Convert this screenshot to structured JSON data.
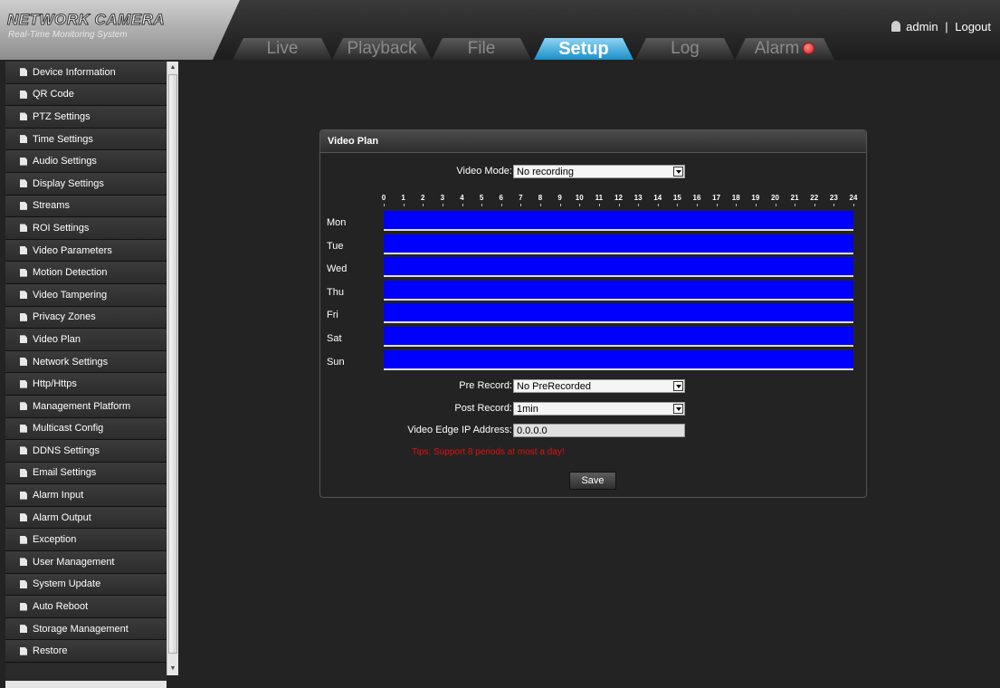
{
  "header": {
    "logo_title": "NETWORK CAMERA",
    "logo_subtitle": "Real-Time Monitoring System",
    "tabs": [
      {
        "label": "Live"
      },
      {
        "label": "Playback"
      },
      {
        "label": "File"
      },
      {
        "label": "Setup"
      },
      {
        "label": "Log"
      },
      {
        "label": "Alarm"
      }
    ],
    "active_tab": "Setup",
    "user": "admin",
    "separator": "|",
    "logout": "Logout",
    "accent_color": "#1a8fc7"
  },
  "sidebar": {
    "items": [
      {
        "label": "Device Information"
      },
      {
        "label": "QR Code"
      },
      {
        "label": "PTZ Settings"
      },
      {
        "label": "Time Settings"
      },
      {
        "label": "Audio Settings"
      },
      {
        "label": "Display Settings"
      },
      {
        "label": "Streams"
      },
      {
        "label": "ROI Settings"
      },
      {
        "label": "Video Parameters"
      },
      {
        "label": "Motion Detection"
      },
      {
        "label": "Video Tampering"
      },
      {
        "label": "Privacy Zones"
      },
      {
        "label": "Video Plan"
      },
      {
        "label": "Network Settings"
      },
      {
        "label": "Http/Https"
      },
      {
        "label": "Management Platform"
      },
      {
        "label": "Multicast Config"
      },
      {
        "label": "DDNS Settings"
      },
      {
        "label": "Email Settings"
      },
      {
        "label": "Alarm Input"
      },
      {
        "label": "Alarm Output"
      },
      {
        "label": "Exception"
      },
      {
        "label": "User Management"
      },
      {
        "label": "System Update"
      },
      {
        "label": "Auto Reboot"
      },
      {
        "label": "Storage Management"
      },
      {
        "label": "Restore"
      }
    ]
  },
  "panel": {
    "title": "Video Plan",
    "video_mode_label": "Video Mode:",
    "video_mode_value": "No recording",
    "hours": [
      "0",
      "1",
      "2",
      "3",
      "4",
      "5",
      "6",
      "7",
      "8",
      "9",
      "10",
      "11",
      "12",
      "13",
      "14",
      "15",
      "16",
      "17",
      "18",
      "19",
      "20",
      "21",
      "22",
      "23",
      "24"
    ],
    "days": [
      "Mon",
      "Tue",
      "Wed",
      "Thu",
      "Fri",
      "Sat",
      "Sun"
    ],
    "schedule_color": "#0000ff",
    "pre_record_label": "Pre Record:",
    "pre_record_value": "No PreRecorded",
    "post_record_label": "Post Record:",
    "post_record_value": "1min",
    "edge_ip_label": "Video Edge IP Address:",
    "edge_ip_value": "0.0.0.0",
    "tips": "Tips: Support 8 periods at most a day!",
    "save_label": "Save"
  }
}
